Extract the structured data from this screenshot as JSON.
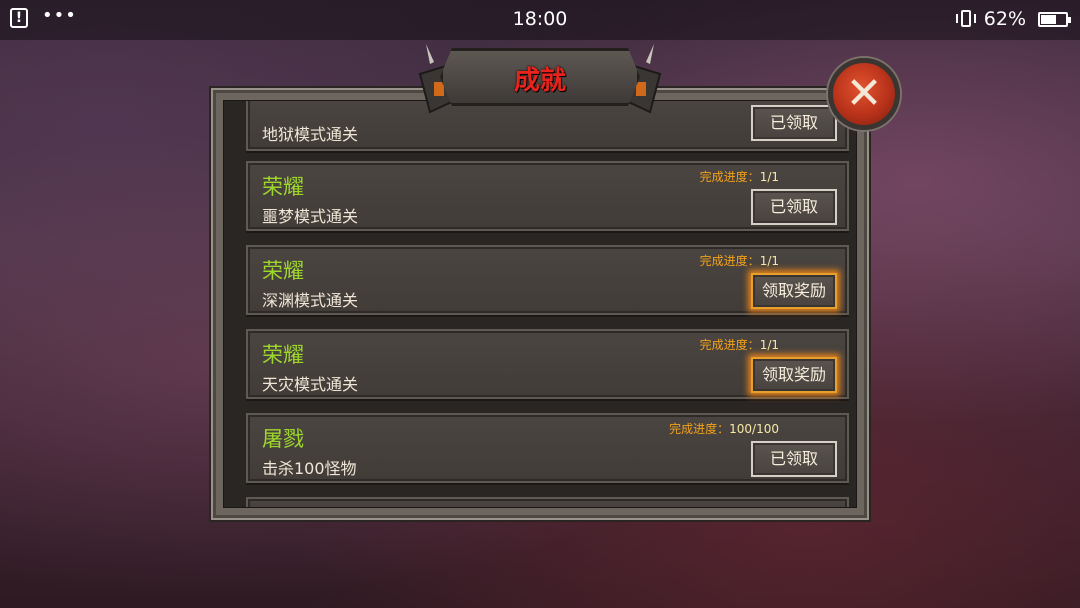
{
  "status_bar": {
    "time": "18:00",
    "battery_percent": "62%",
    "battery_level": 0.62,
    "icons": [
      "alert-icon",
      "more-dots-icon",
      "vibrate-icon",
      "battery-icon"
    ]
  },
  "dialog": {
    "title": "成就",
    "close_icon": "close-x-icon",
    "progress_label": "完成进度：",
    "achievements": [
      {
        "name": "",
        "description": "地狱模式通关",
        "progress": "",
        "button": "已领取",
        "claimable": false
      },
      {
        "name": "荣耀",
        "description": "噩梦模式通关",
        "progress": "1/1",
        "button": "已领取",
        "claimable": false
      },
      {
        "name": "荣耀",
        "description": "深渊模式通关",
        "progress": "1/1",
        "button": "领取奖励",
        "claimable": true
      },
      {
        "name": "荣耀",
        "description": "天灾模式通关",
        "progress": "1/1",
        "button": "领取奖励",
        "claimable": true
      },
      {
        "name": "屠戮",
        "description": "击杀100怪物",
        "progress": "100/100",
        "button": "已领取",
        "claimable": false
      }
    ]
  },
  "colors": {
    "title_red": "#e8231c",
    "name_green": "#9ed72c",
    "progress_orange": "#f2a21b",
    "glow_orange": "#ff8c14",
    "close_red": "#b8321a"
  }
}
